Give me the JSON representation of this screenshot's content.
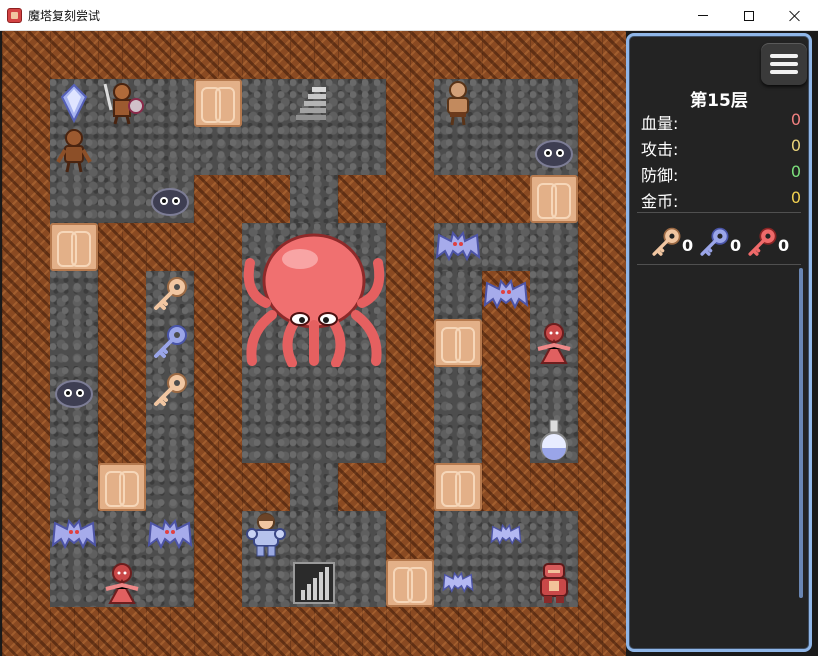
{
  "window": {
    "title": "魔塔复刻尝试",
    "app_icon": "gift-box-icon",
    "controls": [
      "minimize-icon",
      "maximize-icon",
      "close-icon"
    ]
  },
  "hud": {
    "floor": "第15层",
    "stats": [
      {
        "label": "血量:",
        "value": "0",
        "color": "#f08080"
      },
      {
        "label": "攻击:",
        "value": "0",
        "color": "#e8d27a"
      },
      {
        "label": "防御:",
        "value": "0",
        "color": "#7ce07c"
      },
      {
        "label": "金币:",
        "value": "0",
        "color": "#f0d050"
      }
    ],
    "keys": [
      {
        "icon": "yellow-key-icon",
        "count": "0",
        "color": "#f1c6a1"
      },
      {
        "icon": "blue-key-icon",
        "count": "0",
        "color": "#9aa5e8"
      },
      {
        "icon": "red-key-icon",
        "count": "0",
        "color": "#ef6a6a"
      }
    ],
    "menu_icon": "hamburger-menu-icon"
  },
  "colors": {
    "wall": "#8a4a22",
    "floor": "#4d4d4d",
    "door": "#e3b088",
    "sidebar_border": "#8fb6e8"
  }
}
